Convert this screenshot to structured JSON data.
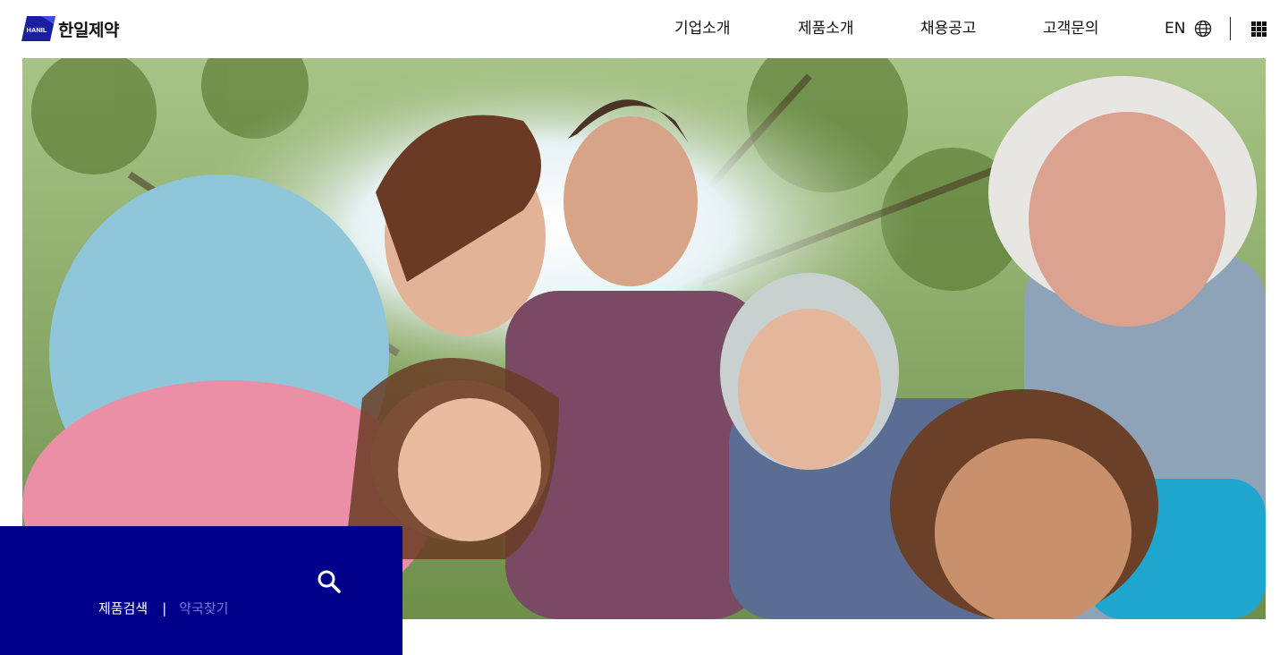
{
  "brand": {
    "logo_mark_text": "HANIL",
    "name": "한일제약",
    "accent": "#00008b"
  },
  "nav": {
    "items": [
      {
        "label": "기업소개"
      },
      {
        "label": "제품소개"
      },
      {
        "label": "채용공고"
      },
      {
        "label": "고객문의"
      }
    ]
  },
  "lang": {
    "label": "EN",
    "icon": "globe-icon"
  },
  "menu": {
    "icon": "grid-menu-icon"
  },
  "hero": {
    "image": "smiling-family-group-photo"
  },
  "search": {
    "icon": "search-icon",
    "tabs": [
      {
        "label": "제품검색",
        "active": true
      },
      {
        "label": "약국찾기",
        "active": false
      }
    ],
    "separator": "|"
  }
}
